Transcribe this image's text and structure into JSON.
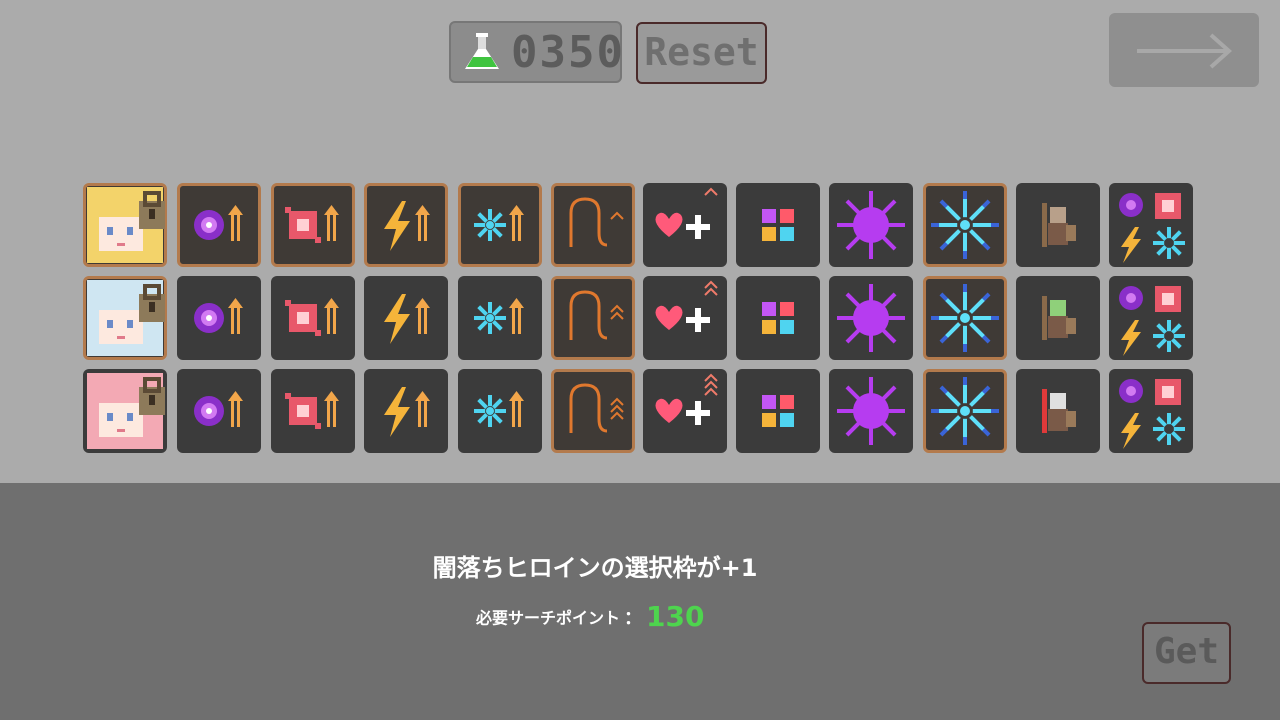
{
  "top_bar": {
    "research_points": "0350",
    "reset_label": "Reset"
  },
  "icon_columns": [
    "heroine-portrait",
    "dark-orb-power-up",
    "red-gem-power-up",
    "lightning-power-up",
    "ice-crystal-power-up",
    "whip-level-up",
    "heal-boost",
    "colored-tiles",
    "purple-sun",
    "blue-snowflake",
    "enemy-unit",
    "all-elements-bundle"
  ],
  "rows": [
    {
      "heroine": "blonde-heroine",
      "locked": true,
      "selected_columns": [
        0,
        1,
        2,
        3,
        4,
        5,
        9
      ],
      "whip_level": 1,
      "heal_level": 1,
      "enemy": "knight"
    },
    {
      "heroine": "silver-hair-heroine",
      "locked": true,
      "selected_columns": [
        0,
        5,
        9
      ],
      "whip_level": 2,
      "heal_level": 2,
      "enemy": "goblin"
    },
    {
      "heroine": "pink-hair-heroine",
      "locked": true,
      "selected_columns": [
        5,
        9
      ],
      "whip_level": 3,
      "heal_level": 3,
      "enemy": "red-warrior"
    }
  ],
  "panel": {
    "description": "闇落ちヒロインの選択枠が+1",
    "cost_label": "必要サーチポイント",
    "cost_colon": "：",
    "cost_value": "130",
    "get_label": "Get"
  },
  "colors": {
    "background": "#ababab",
    "panel": "#6f6f6f",
    "cell": "#3b3b3b",
    "selected_border": "#b37a4c",
    "cost_value": "#4ed44e"
  }
}
